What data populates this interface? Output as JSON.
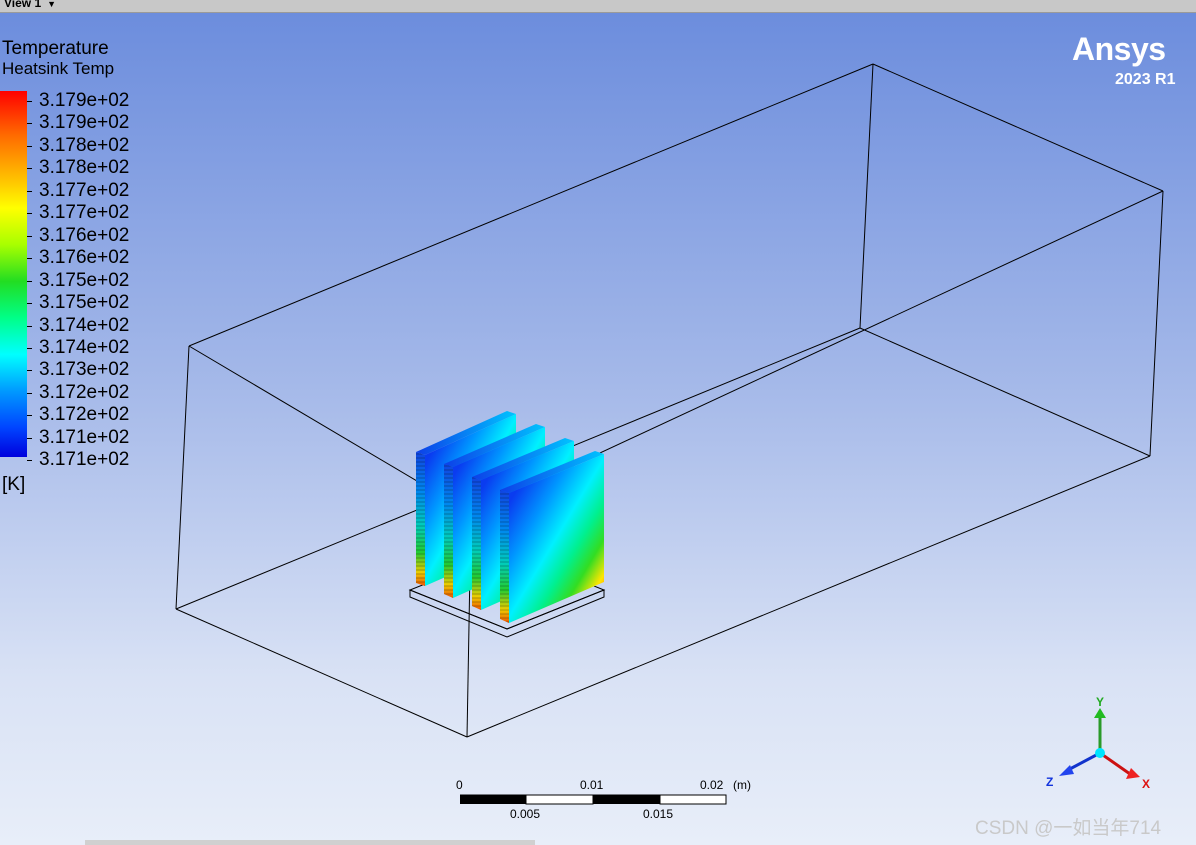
{
  "view_tab": {
    "label": "View 1"
  },
  "legend": {
    "title": "Temperature",
    "subtitle": "Heatsink Temp",
    "unit": "[K]",
    "labels": [
      "3.179e+02",
      "3.179e+02",
      "3.178e+02",
      "3.178e+02",
      "3.177e+02",
      "3.177e+02",
      "3.176e+02",
      "3.176e+02",
      "3.175e+02",
      "3.175e+02",
      "3.174e+02",
      "3.174e+02",
      "3.173e+02",
      "3.172e+02",
      "3.172e+02",
      "3.171e+02",
      "3.171e+02"
    ],
    "colors": {
      "max": "#ff0000",
      "mid": "#22dd22",
      "min": "#0000dd"
    }
  },
  "logo": {
    "name": "Ansys",
    "version": "2023 R1"
  },
  "scale": {
    "unit": "(m)",
    "top_labels": [
      "0",
      "0.01",
      "0.02"
    ],
    "bottom_labels": [
      "0.005",
      "0.015"
    ]
  },
  "axes": {
    "x": "X",
    "y": "Y",
    "z": "Z"
  },
  "watermark": "CSDN @一如当年714"
}
